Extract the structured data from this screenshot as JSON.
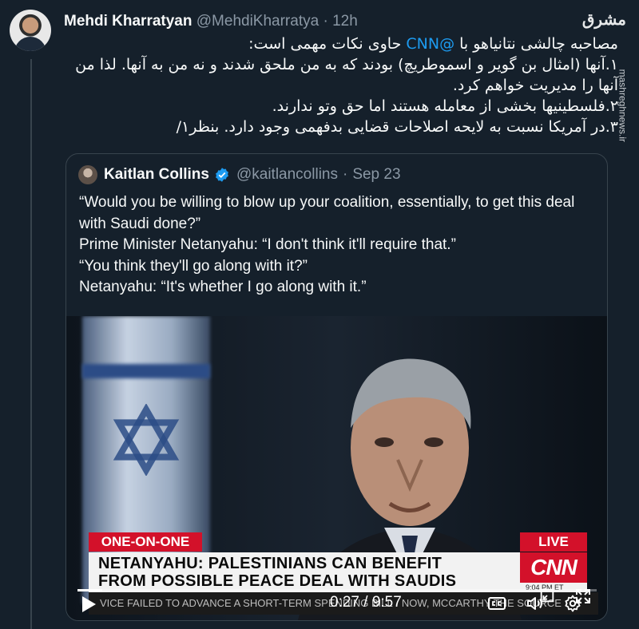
{
  "tweet": {
    "author_name": "Mehdi Kharratyan",
    "author_handle": "@MehdiKharratya",
    "separator": "·",
    "time": "12h",
    "body_intro_prefix": "مصاحبه چالشی نتانیاهو با ",
    "body_mention": "@CNN",
    "body_intro_suffix": " حاوی نکات مهمی است:",
    "body_line_1": "۱.آنها (امثال بن گویر و اسموطریچ) بودند که به من ملحق شدند و نه من به آنها. لذا من آنها را مدیریت خواهم کرد.",
    "body_line_2": "۲.فلسطینیها بخشی از معامله هستند اما حق وتو ندارند.",
    "body_line_3": "۳.در آمریکا نسبت به لایحه اصلاحات قضایی بدفهمی وجود دارد.  بنظر۱/"
  },
  "watermark": {
    "logo_text": "مشرق",
    "url": "mashreghnews.ir"
  },
  "quoted_tweet": {
    "author_name": "Kaitlan Collins",
    "author_handle": "@kaitlancollins",
    "separator": "·",
    "time": "Sep 23",
    "verified_color": "#1d9bf0",
    "line_1": "“Would you be willing to blow up your coalition, essentially, to get this deal with Saudi done?”",
    "line_2": "Prime Minister Netanyahu:  “I don't think it'll require that.”",
    "line_3": "“You think they'll go along with it?”",
    "line_4": "Netanyahu: “It's whether I go along with it.”"
  },
  "video": {
    "chyron_top": "ONE-ON-ONE",
    "chyron_live": "LIVE",
    "chyron_line_1": "NETANYAHU: PALESTINIANS CAN BENEFIT",
    "chyron_line_2": "FROM POSSIBLE PEACE DEAL WITH SAUDIS",
    "network_logo": "CNN",
    "clock": "9:04 PM ET",
    "ticker": "VICE FAILED TO ADVANCE A SHORT-TERM SPENDING BILL · NOW, MCCARTHY THE SOURCE",
    "current_time": "0:27",
    "duration": "9:57",
    "time_separator": " / ",
    "progress_fraction": 0.047,
    "accent_red": "#d3112a"
  }
}
